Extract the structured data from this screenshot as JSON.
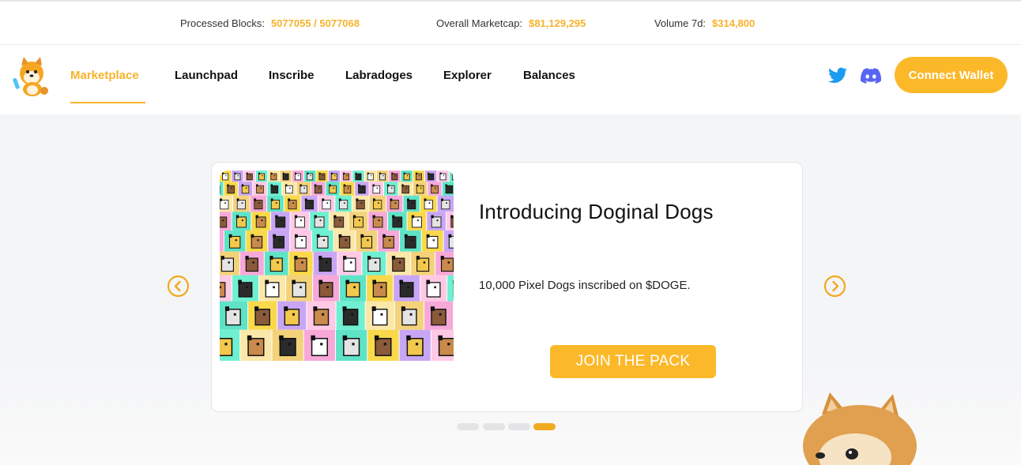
{
  "stats": {
    "processed_blocks_label": "Processed Blocks:",
    "processed_blocks_value": "5077055 / 5077068",
    "marketcap_label": "Overall Marketcap:",
    "marketcap_value": "$81,129,295",
    "volume_label": "Volume 7d:",
    "volume_value": "$314,800"
  },
  "nav": {
    "logo_icon": "doge-mascot-logo",
    "items": [
      {
        "label": "Marketplace",
        "active": true
      },
      {
        "label": "Launchpad",
        "active": false
      },
      {
        "label": "Inscribe",
        "active": false
      },
      {
        "label": "Labradoges",
        "active": false
      },
      {
        "label": "Explorer",
        "active": false
      },
      {
        "label": "Balances",
        "active": false
      }
    ],
    "twitter_icon": "twitter-icon",
    "discord_icon": "discord-icon",
    "connect_wallet_label": "Connect Wallet"
  },
  "carousel": {
    "title": "Introducing Doginal Dogs",
    "description": "10,000 Pixel Dogs inscribed on $DOGE.",
    "cta_label": "JOIN THE PACK",
    "slide_count": 4,
    "active_slide": 4,
    "prev_icon": "chevron-left-circle-icon",
    "next_icon": "chevron-right-circle-icon"
  },
  "colors": {
    "accent": "#fbb829",
    "accent_text": "#f7b32b",
    "background": "#f4f5f7",
    "twitter": "#1d9bf0",
    "discord": "#5865f2"
  }
}
